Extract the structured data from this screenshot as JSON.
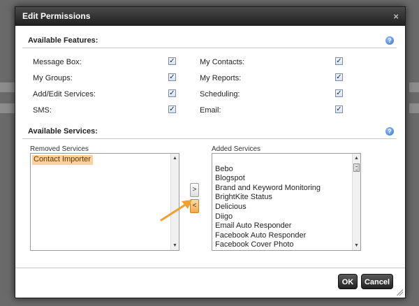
{
  "dialog": {
    "title": "Edit Permissions",
    "close_glyph": "×",
    "help_glyph": "?"
  },
  "features": {
    "heading": "Available Features:",
    "left": [
      {
        "label": "Message Box:",
        "checked": true
      },
      {
        "label": "My Groups:",
        "checked": true
      },
      {
        "label": "Add/Edit Services:",
        "checked": true
      },
      {
        "label": "SMS:",
        "checked": true
      }
    ],
    "right": [
      {
        "label": "My Contacts:",
        "checked": true
      },
      {
        "label": "My Reports:",
        "checked": true
      },
      {
        "label": "Scheduling:",
        "checked": true
      },
      {
        "label": "Email:",
        "checked": true
      }
    ],
    "check_glyph": "✓"
  },
  "services": {
    "heading": "Available Services:",
    "removed": {
      "caption": "Removed Services",
      "items": [
        "Contact Importer"
      ],
      "selected_index": 0
    },
    "added": {
      "caption": "Added Services",
      "items": [
        "",
        "Bebo",
        "Blogspot",
        "Brand and Keyword Monitoring",
        "BrightKite Status",
        "Delicious",
        "Diigo",
        "Email Auto Responder",
        "Facebook Auto Responder",
        "Facebook Cover Photo"
      ]
    },
    "add_button": ">",
    "remove_button": "<"
  },
  "buttons": {
    "ok": "OK",
    "cancel": "Cancel"
  },
  "colors": {
    "selection": "#fcd09c",
    "highlight_button": "#f4a94a",
    "pointer": "#f0a030"
  }
}
